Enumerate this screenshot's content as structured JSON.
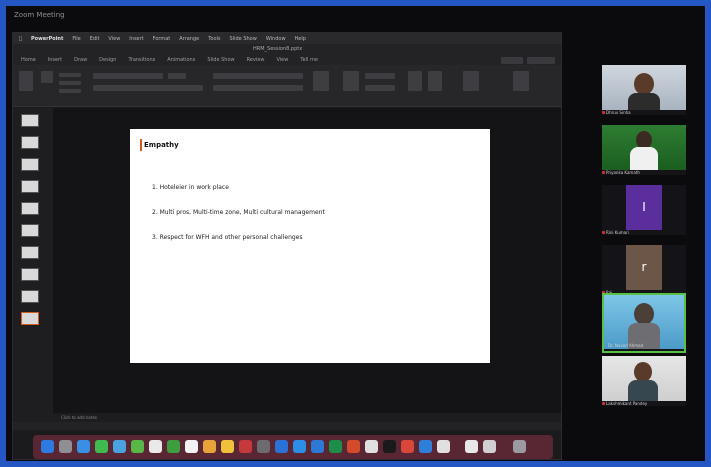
{
  "zoom": {
    "window_title": "Zoom Meeting"
  },
  "mac_menubar": {
    "app": "PowerPoint",
    "items": [
      "File",
      "Edit",
      "View",
      "Insert",
      "Format",
      "Arrange",
      "Tools",
      "Slide Show",
      "Window",
      "Help"
    ]
  },
  "document": {
    "title": "HRM_Session8.pptx"
  },
  "ribbon": {
    "tabs": [
      "Home",
      "Insert",
      "Draw",
      "Design",
      "Transitions",
      "Animations",
      "Slide Show",
      "Review",
      "View",
      "Tell me"
    ],
    "share_label": "Share",
    "comments_label": "Comments"
  },
  "slide": {
    "title": "Empathy",
    "items": [
      "1. Hoteleier in work place",
      "2. Multi pros, Multi-time zone, Multi cultural management",
      "3. Respect for WFH and other personal challenges"
    ]
  },
  "notes": {
    "label": "Click to add notes"
  },
  "participants": [
    {
      "name": "Dhruv Sinha",
      "video": "person"
    },
    {
      "name": "Priyanka Kamath",
      "video": "person"
    },
    {
      "name": "Rini Kumari",
      "video": "initial",
      "initial": "I",
      "bg": "#5b2e9e"
    },
    {
      "name": "Raj",
      "video": "initial",
      "initial": "r",
      "bg": "#6b5647"
    },
    {
      "name": "Dr. Naved Ahmad",
      "video": "person",
      "active": true
    },
    {
      "name": "Lakshmikant Pandey",
      "video": "person"
    }
  ],
  "colors": {
    "frame_border": "#2456c4",
    "active_speaker": "#58c045",
    "slide_accent": "#d35b1a"
  }
}
